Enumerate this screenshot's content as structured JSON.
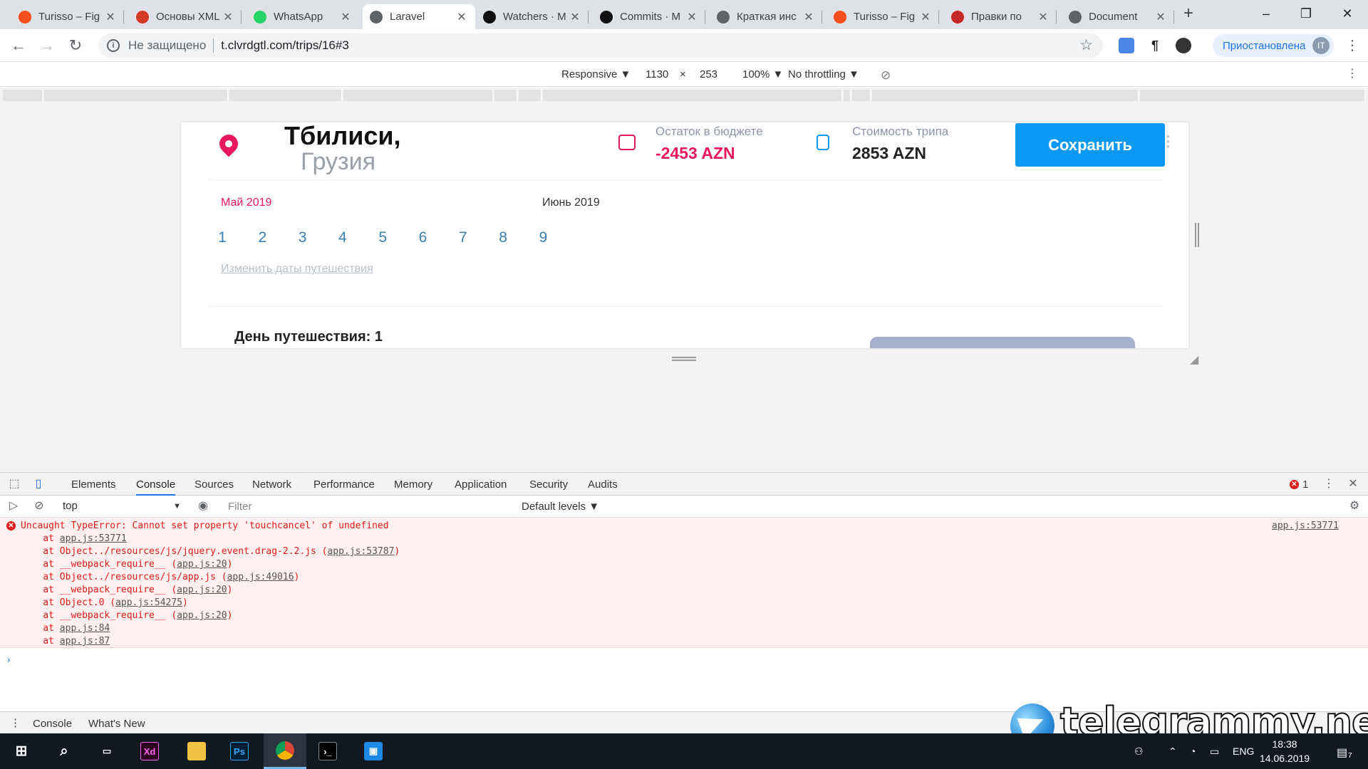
{
  "browser": {
    "tabs": [
      {
        "title": "Turisso – Fig",
        "favicon": "figma-icon",
        "color": "#f24e1e"
      },
      {
        "title": "Основы XML",
        "favicon": "xml-icon",
        "color": "#d23a2a"
      },
      {
        "title": "WhatsApp",
        "favicon": "whatsapp-icon",
        "color": "#25d366"
      },
      {
        "title": "Laravel",
        "favicon": "globe-icon",
        "color": "#5f6368"
      },
      {
        "title": "Watchers · M",
        "favicon": "github-icon",
        "color": "#111111"
      },
      {
        "title": "Commits · M",
        "favicon": "github-icon",
        "color": "#111111"
      },
      {
        "title": "Краткая инс",
        "favicon": "globe-icon",
        "color": "#5f6368"
      },
      {
        "title": "Turisso – Fig",
        "favicon": "figma-icon",
        "color": "#f24e1e"
      },
      {
        "title": "Правки по",
        "favicon": "doc-icon",
        "color": "#c62828"
      },
      {
        "title": "Document",
        "favicon": "globe-icon",
        "color": "#5f6368"
      }
    ],
    "active_tab": 3,
    "omnibox": {
      "security": "Не защищено",
      "url": "t.clvrdgtl.com/trips/16#3"
    },
    "profile": {
      "label": "Приостановлена",
      "initial": "IT"
    }
  },
  "device_toolbar": {
    "mode": "Responsive ▼",
    "width": "1130",
    "times": "×",
    "height": "253",
    "zoom": "100% ▼",
    "throttling": "No throttling ▼"
  },
  "page": {
    "city": "Тбилиси,",
    "country": "Грузия",
    "budget_label": "Остаток в бюджете",
    "budget_value": "-2453 AZN",
    "cost_label": "Стоимость трипа",
    "cost_value": "2853 AZN",
    "save_label": "Сохранить",
    "month_current": "Май 2019",
    "month_next": "Июнь 2019",
    "days": [
      "1",
      "2",
      "3",
      "4",
      "5",
      "6",
      "7",
      "8",
      "9"
    ],
    "change_dates": "Изменить даты путешествия",
    "day_title": "День путешествия: 1",
    "colors": {
      "accent_red": "#e8175d",
      "accent_blue": "#0a99f2",
      "day_blue": "#3a7fb0"
    }
  },
  "devtools": {
    "tabs": [
      "Elements",
      "Console",
      "Sources",
      "Network",
      "Performance",
      "Memory",
      "Application",
      "Security",
      "Audits"
    ],
    "active_tab": "Console",
    "error_count": "1",
    "context": "top",
    "filter_placeholder": "Filter",
    "levels": "Default levels ▼",
    "error": {
      "message": "Uncaught TypeError: Cannot set property 'touchcancel' of undefined",
      "source": "app.js:53771",
      "stack": [
        {
          "prefix": "    at ",
          "text": "",
          "link": "app.js:53771",
          "suffix": ""
        },
        {
          "prefix": "    at ",
          "text": "Object../resources/js/jquery.event.drag-2.2.js (",
          "link": "app.js:53787",
          "suffix": ")"
        },
        {
          "prefix": "    at ",
          "text": "__webpack_require__ (",
          "link": "app.js:20",
          "suffix": ")"
        },
        {
          "prefix": "    at ",
          "text": "Object../resources/js/app.js (",
          "link": "app.js:49016",
          "suffix": ")"
        },
        {
          "prefix": "    at ",
          "text": "__webpack_require__ (",
          "link": "app.js:20",
          "suffix": ")"
        },
        {
          "prefix": "    at ",
          "text": "Object.0 (",
          "link": "app.js:54275",
          "suffix": ")"
        },
        {
          "prefix": "    at ",
          "text": "__webpack_require__ (",
          "link": "app.js:20",
          "suffix": ")"
        },
        {
          "prefix": "    at ",
          "text": "",
          "link": "app.js:84",
          "suffix": ""
        },
        {
          "prefix": "    at ",
          "text": "",
          "link": "app.js:87",
          "suffix": ""
        }
      ]
    },
    "prompt": "›",
    "drawer_tabs": [
      "Console",
      "What's New"
    ]
  },
  "watermark": "telegrammy.net",
  "taskbar": {
    "lang": "ENG",
    "time": "18:38",
    "date": "14.06.2019",
    "notifications": "7"
  }
}
